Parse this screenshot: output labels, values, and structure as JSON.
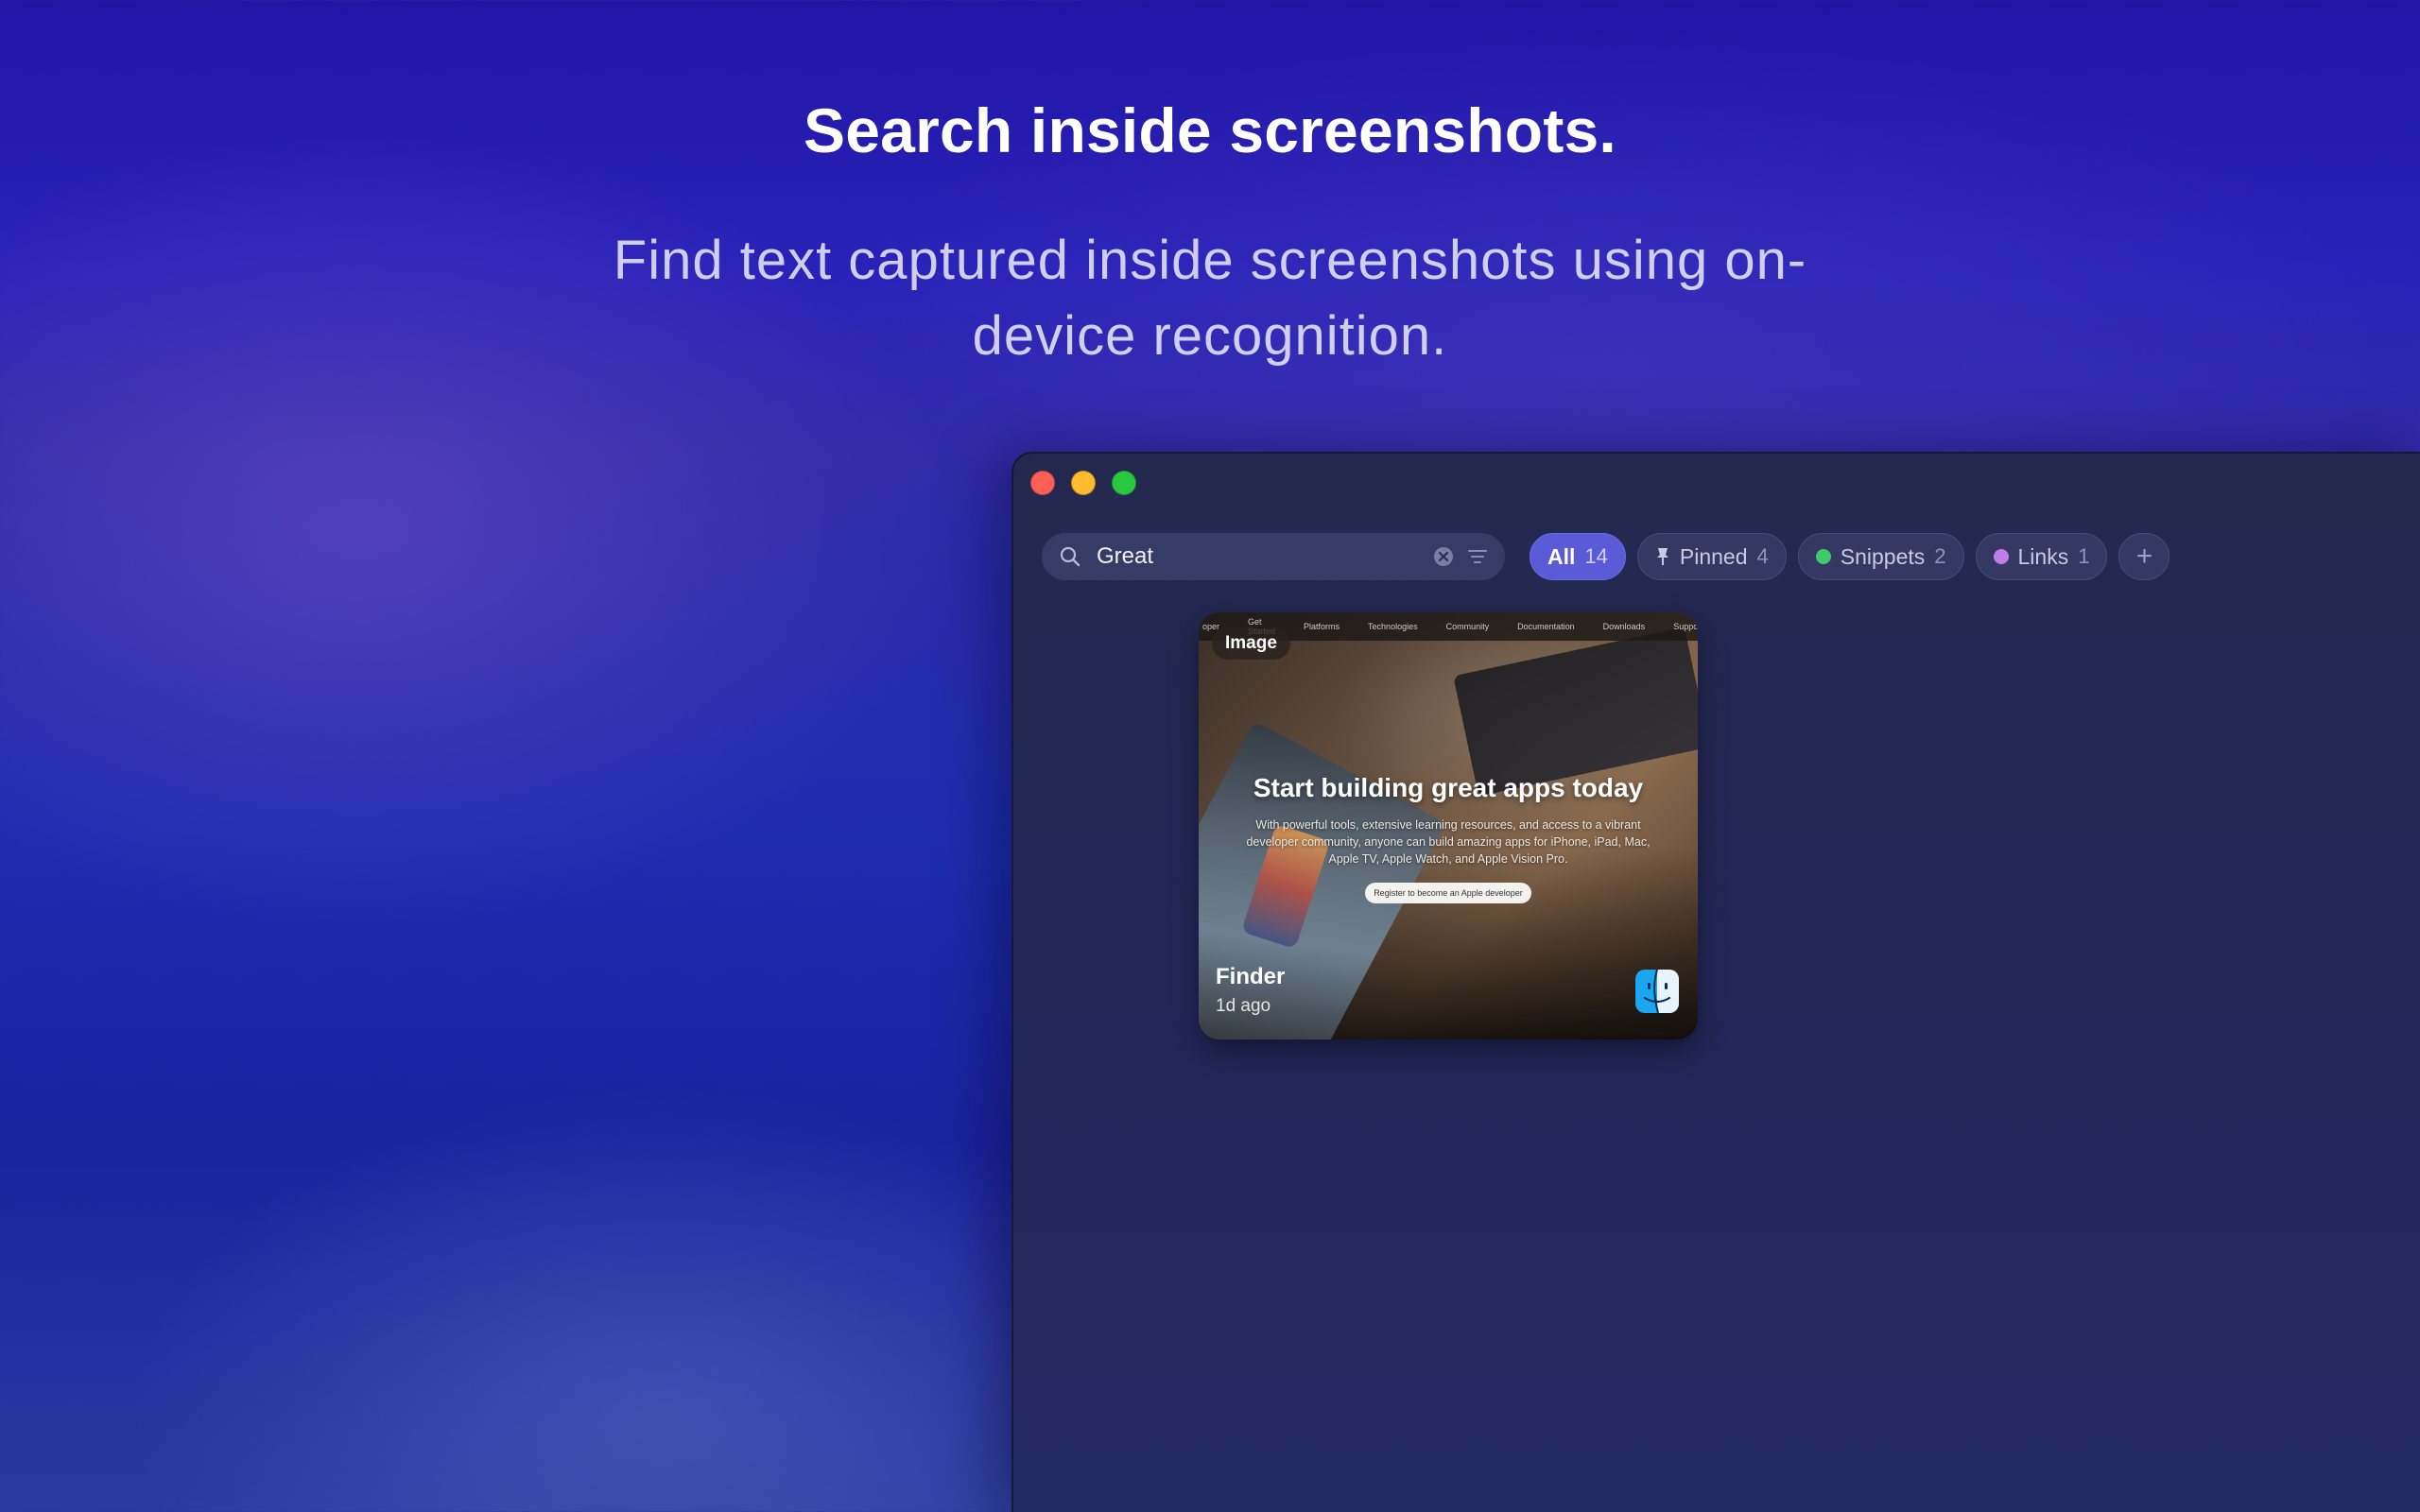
{
  "hero": {
    "title": "Search inside screenshots.",
    "subtitle": "Find text captured inside screenshots using on-device recognition."
  },
  "window": {
    "search": {
      "value": "Great",
      "icon": "search-icon"
    },
    "chips": [
      {
        "label": "All",
        "count": "14",
        "active": true
      },
      {
        "label": "Pinned",
        "count": "4",
        "icon": "pin-icon"
      },
      {
        "label": "Snippets",
        "count": "2",
        "dot_color": "#3ec96a"
      },
      {
        "label": "Links",
        "count": "1",
        "dot_color": "#c07ee8"
      }
    ],
    "add_label": "+",
    "card": {
      "badge": "Image",
      "nav_items": [
        "oper",
        "Get Started",
        "Platforms",
        "Technologies",
        "Community",
        "Documentation",
        "Downloads",
        "Support"
      ],
      "headline": "Start building great apps today",
      "body": "With powerful tools, extensive learning resources, and access to a vibrant developer community, anyone can build amazing apps for iPhone, iPad, Mac, Apple TV, Apple Watch, and Apple Vision Pro.",
      "cta": "Register to become an Apple developer",
      "app_name": "Finder",
      "time": "1d ago",
      "app_icon": "finder-icon"
    }
  },
  "colors": {
    "accent": "#5a5bd6",
    "snippets_dot": "#3ec96a",
    "links_dot": "#c07ee8"
  }
}
